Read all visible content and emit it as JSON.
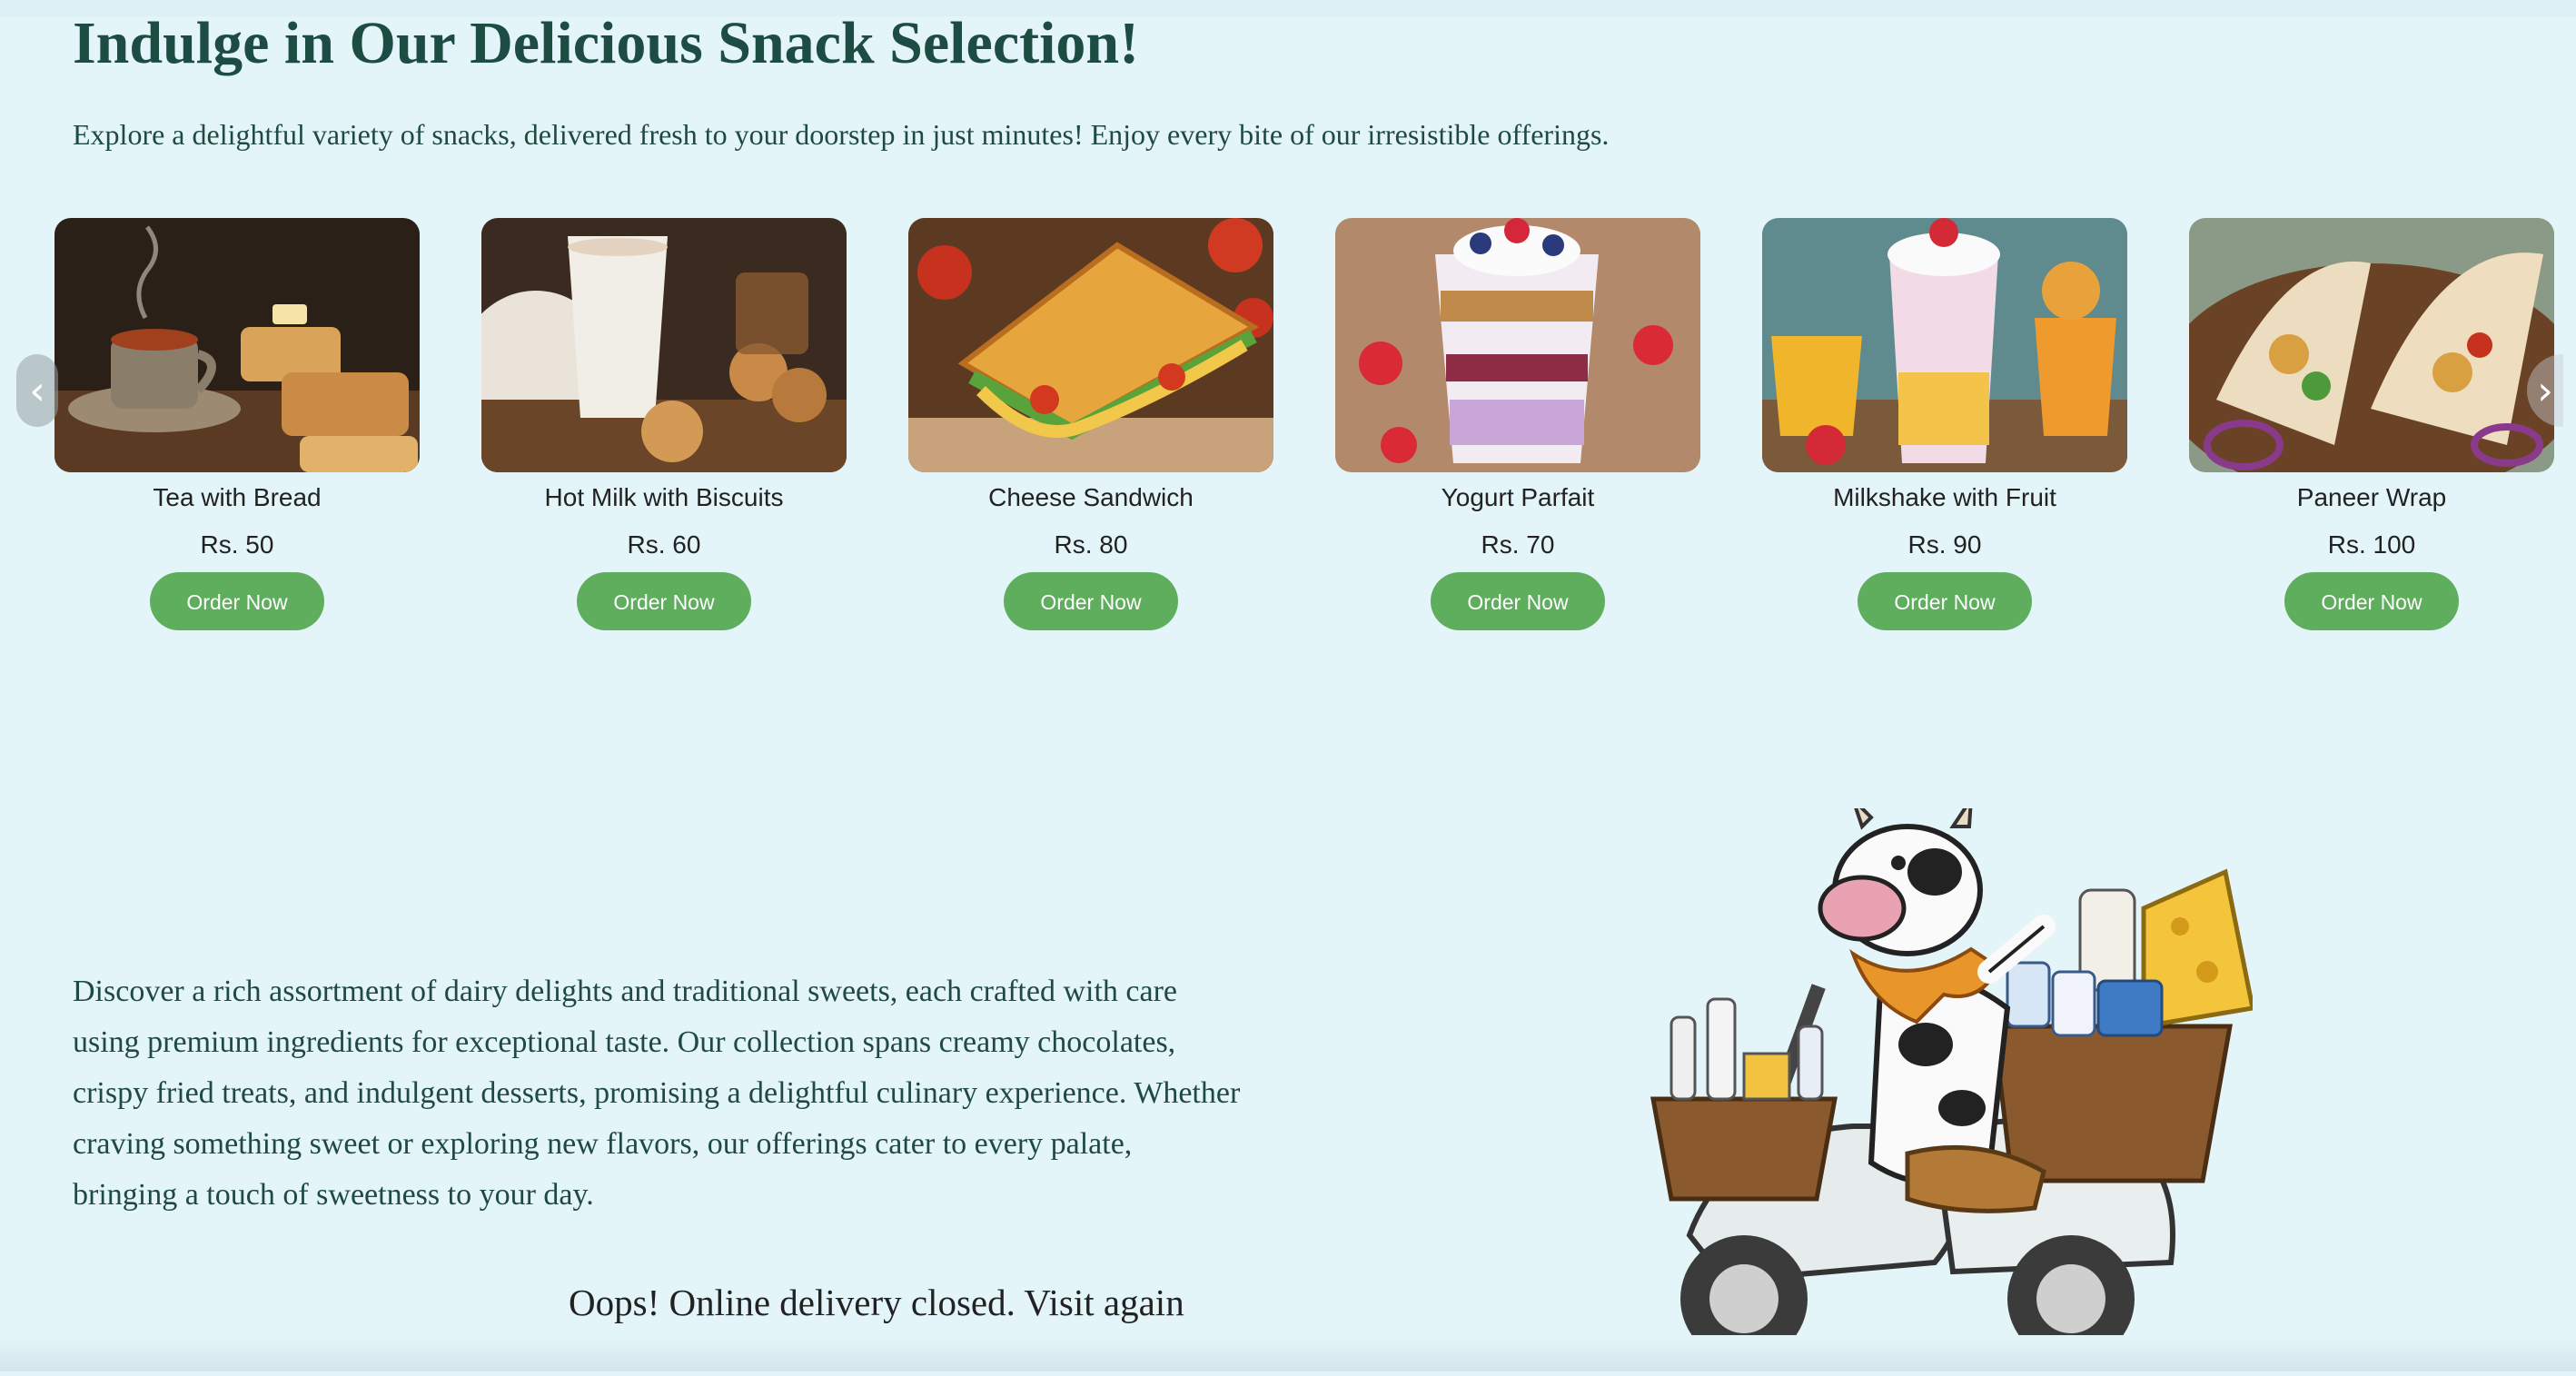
{
  "header": {
    "title": "Indulge in Our Delicious Snack Selection!",
    "subtitle": "Explore a delightful variety of snacks, delivered fresh to your doorstep in just minutes! Enjoy every bite of our irresistible offerings."
  },
  "carousel": {
    "prev_icon": "chevron-left-icon",
    "next_icon": "chevron-right-icon",
    "prev_glyph": "‹",
    "next_glyph": "›",
    "items": [
      {
        "name": "Tea with Bread",
        "price": "Rs. 50",
        "button": "Order Now"
      },
      {
        "name": "Hot Milk with Biscuits",
        "price": "Rs. 60",
        "button": "Order Now"
      },
      {
        "name": "Cheese Sandwich",
        "price": "Rs. 80",
        "button": "Order Now"
      },
      {
        "name": "Yogurt Parfait",
        "price": "Rs. 70",
        "button": "Order Now"
      },
      {
        "name": "Milkshake with Fruit",
        "price": "Rs. 90",
        "button": "Order Now"
      },
      {
        "name": "Paneer Wrap",
        "price": "Rs. 100",
        "button": "Order Now"
      }
    ]
  },
  "about": {
    "text": "Discover a rich assortment of dairy delights and traditional sweets, each crafted with care using premium ingredients for exceptional taste. Our collection spans creamy chocolates, crispy fried treats, and indulgent desserts, promising a delightful culinary experience. Whether craving something sweet or exploring new flavors, our offerings cater to every palate, bringing a touch of sweetness to your day.",
    "closed_notice": "Oops! Online delivery closed. Visit again"
  },
  "colors": {
    "background": "#e4f5f9",
    "heading": "#1d4d42",
    "button": "#5fae5e"
  }
}
